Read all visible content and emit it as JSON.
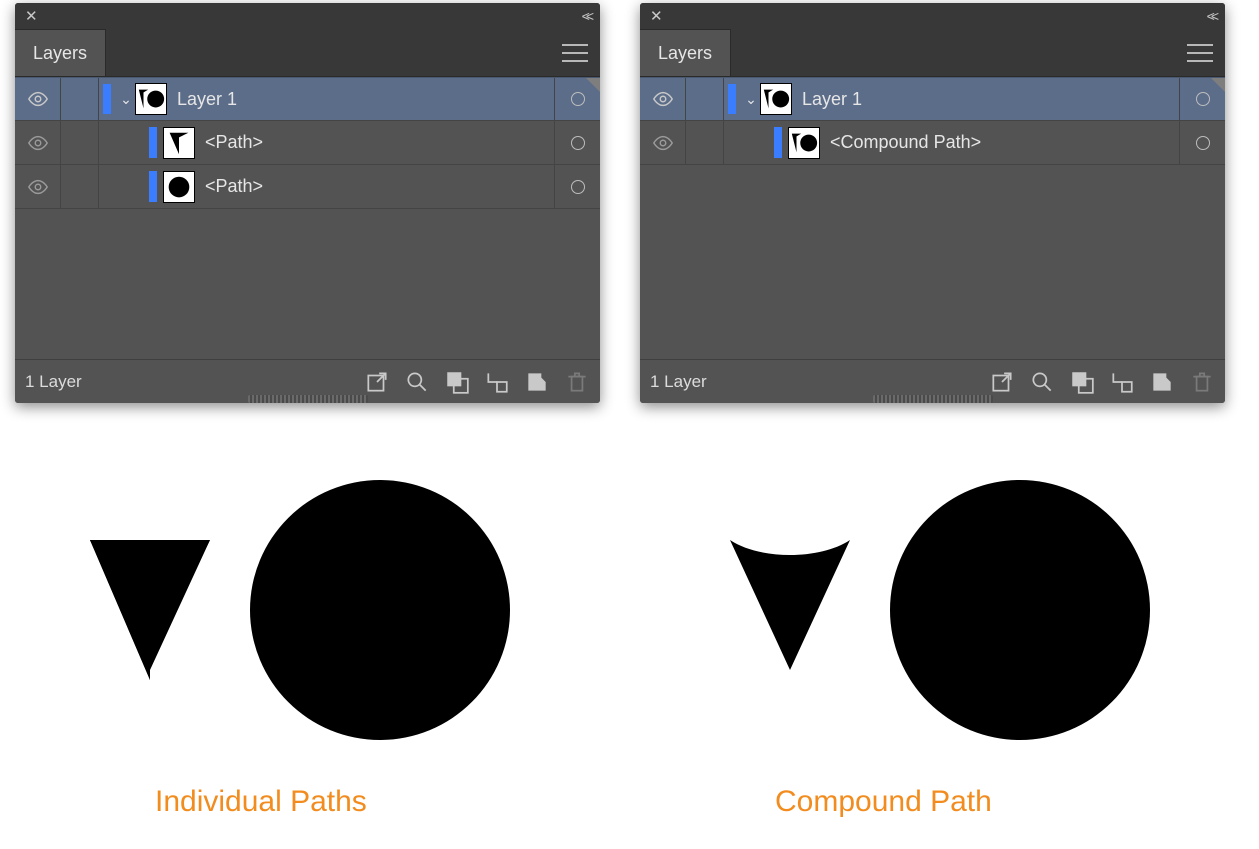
{
  "panels": {
    "left": {
      "tab_label": "Layers",
      "status_text": "1 Layer",
      "rows": [
        {
          "label": "Layer 1",
          "selected": true,
          "disclosure": "open",
          "thumb": "combo",
          "indent": 0
        },
        {
          "label": "<Path>",
          "selected": false,
          "thumb": "triangle",
          "indent": 1
        },
        {
          "label": "<Path>",
          "selected": false,
          "thumb": "circle",
          "indent": 1
        }
      ]
    },
    "right": {
      "tab_label": "Layers",
      "status_text": "1 Layer",
      "rows": [
        {
          "label": "Layer 1",
          "selected": true,
          "disclosure": "open",
          "thumb": "combo",
          "indent": 0
        },
        {
          "label": "<Compound Path>",
          "selected": false,
          "thumb": "combo",
          "indent": 1
        }
      ]
    }
  },
  "captions": {
    "left": "Individual Paths",
    "right": "Compound Path"
  },
  "colors": {
    "layer_color": "#3b7dff",
    "caption_color": "#f28c1e"
  }
}
